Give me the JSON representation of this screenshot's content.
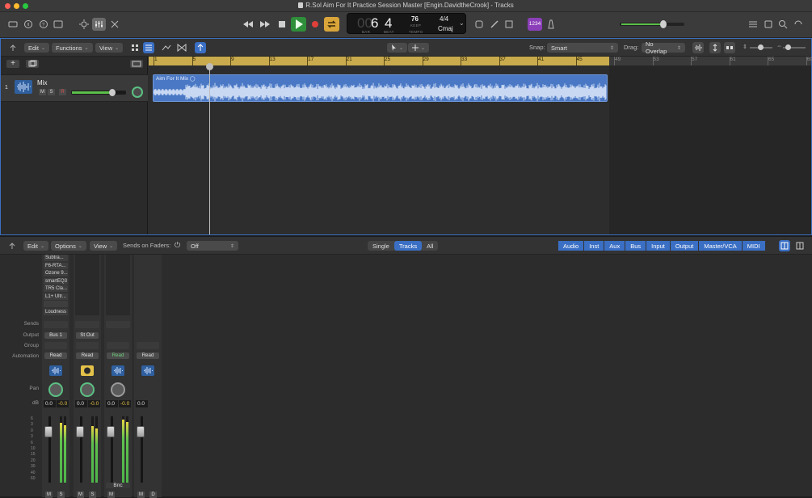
{
  "window": {
    "title": "R.Sol Aim For It Practice Session Master [Engin.DavidtheCrook] - Tracks"
  },
  "lcd": {
    "bar": "6",
    "beat": "4",
    "bar_label": "BAR",
    "beat_label": "BEAT",
    "tempo": "76",
    "tempo_keep": "KEEP",
    "tempo_label": "TEMPO",
    "signature": "4/4",
    "key": "Cmaj"
  },
  "control_bar": {
    "counter_badge": "1234"
  },
  "tracks_toolbar": {
    "edit_label": "Edit",
    "functions_label": "Functions",
    "view_label": "View",
    "snap_label": "Snap:",
    "snap_value": "Smart",
    "drag_label": "Drag:",
    "drag_value": "No Overlap"
  },
  "ruler": {
    "bars": [
      "1",
      "5",
      "9",
      "13",
      "17",
      "21",
      "25",
      "29",
      "33",
      "37",
      "41",
      "45",
      "49",
      "53",
      "57",
      "61",
      "65",
      "69"
    ]
  },
  "track": {
    "number": "1",
    "name": "Mix",
    "mute": "M",
    "solo": "S",
    "record": "R"
  },
  "region": {
    "name": "Aim For It Mix"
  },
  "mixer_toolbar": {
    "edit_label": "Edit",
    "options_label": "Options",
    "view_label": "View",
    "sends_on_faders_label": "Sends on Faders:",
    "sends_on_faders_value": "Off",
    "view_modes": [
      "Single",
      "Tracks",
      "All"
    ],
    "filters": [
      "Audio",
      "Inst",
      "Aux",
      "Bus",
      "Input",
      "Output",
      "Master/VCA",
      "MIDI"
    ]
  },
  "mixer_rows": {
    "sends": "Sends",
    "output": "Output",
    "group": "Group",
    "automation": "Automation",
    "pan": "Pan",
    "db": "dB"
  },
  "plugins": [
    "Subtra...",
    "F6-RTA...",
    "Ozone 9...",
    "smartEQ3",
    "TR5 Cla...",
    "L1+ Ultr...",
    "",
    "Loudness"
  ],
  "strips": [
    {
      "output": "Bus 1",
      "automation": "Read",
      "vol": "0.0",
      "peak": "-0.0",
      "btn_m": "M",
      "btn_s": "S",
      "label": ""
    },
    {
      "output": "St Out",
      "automation": "Read",
      "vol": "0.0",
      "peak": "-0.0",
      "btn_m": "M",
      "btn_s": "S",
      "label": ""
    },
    {
      "output": "",
      "automation": "Read",
      "vol": "0.0",
      "peak": "-0.0",
      "btn_m": "M",
      "btn_s": "",
      "label": "Bnc"
    },
    {
      "output": "",
      "automation": "Read",
      "vol": "0.0",
      "peak": "",
      "btn_m": "M",
      "btn_s": "D",
      "label": ""
    }
  ],
  "fader_scale": [
    "6",
    "3",
    "0",
    "3",
    "6",
    "10",
    "15",
    "20",
    "30",
    "40",
    "60"
  ]
}
